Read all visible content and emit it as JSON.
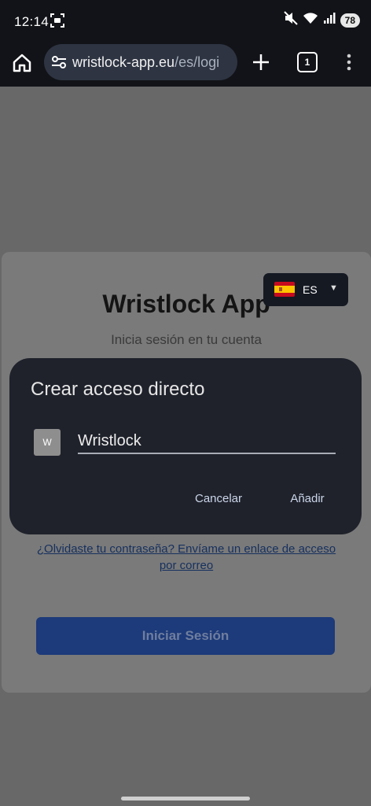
{
  "status_bar": {
    "time": "12:14",
    "battery": "78",
    "icons": [
      "screenshot-icon",
      "mute-icon",
      "wifi-icon",
      "signal-icon"
    ]
  },
  "browser": {
    "url_host": "wristlock-app.eu",
    "url_path": "/es/logi",
    "tab_count": "1",
    "icons": [
      "home-icon",
      "site-settings-icon",
      "plus-icon",
      "more-vert-icon"
    ]
  },
  "login": {
    "title": "Wristlock App",
    "subtitle": "Inicia sesión en tu cuenta",
    "language": {
      "flag": "spain-flag-icon",
      "code": "ES",
      "caret": "▼"
    },
    "forgot_link": "¿Olvidaste tu contraseña? Envíame un enlace de acceso por correo",
    "submit_label": "Iniciar Sesión"
  },
  "dialog": {
    "title": "Crear acceso directo",
    "icon_letter": "W",
    "name_value": "Wristlock",
    "cancel_label": "Cancelar",
    "add_label": "Añadir"
  },
  "colors": {
    "dialog_bg": "#1f222b",
    "dialog_button_text": "#cbd6ea",
    "login_button": "#1d3a7a",
    "scrim": "#686868"
  }
}
